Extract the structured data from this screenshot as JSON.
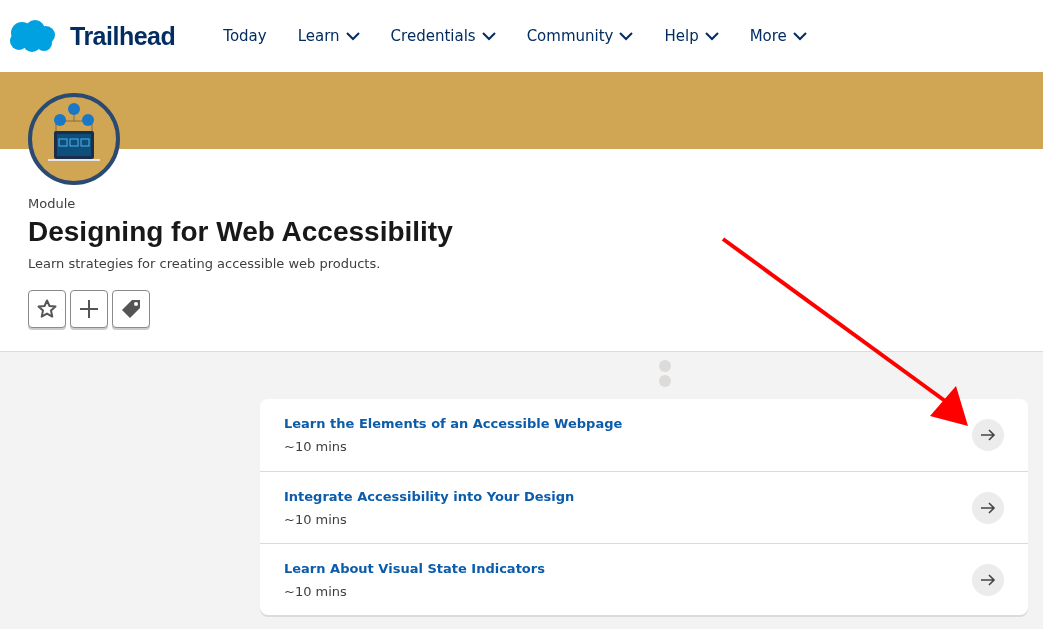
{
  "header": {
    "logo_text": "Trailhead",
    "nav": [
      {
        "label": "Today",
        "dropdown": false
      },
      {
        "label": "Learn",
        "dropdown": true
      },
      {
        "label": "Credentials",
        "dropdown": true
      },
      {
        "label": "Community",
        "dropdown": true
      },
      {
        "label": "Help",
        "dropdown": true
      },
      {
        "label": "More",
        "dropdown": true
      }
    ]
  },
  "module": {
    "kind_label": "Module",
    "title": "Designing for Web Accessibility",
    "description": "Learn strategies for creating accessible web products."
  },
  "units": [
    {
      "title": "Learn the Elements of an Accessible Webpage",
      "duration": "~10 mins"
    },
    {
      "title": "Integrate Accessibility into Your Design",
      "duration": "~10 mins"
    },
    {
      "title": "Learn About Visual State Indicators",
      "duration": "~10 mins"
    }
  ]
}
